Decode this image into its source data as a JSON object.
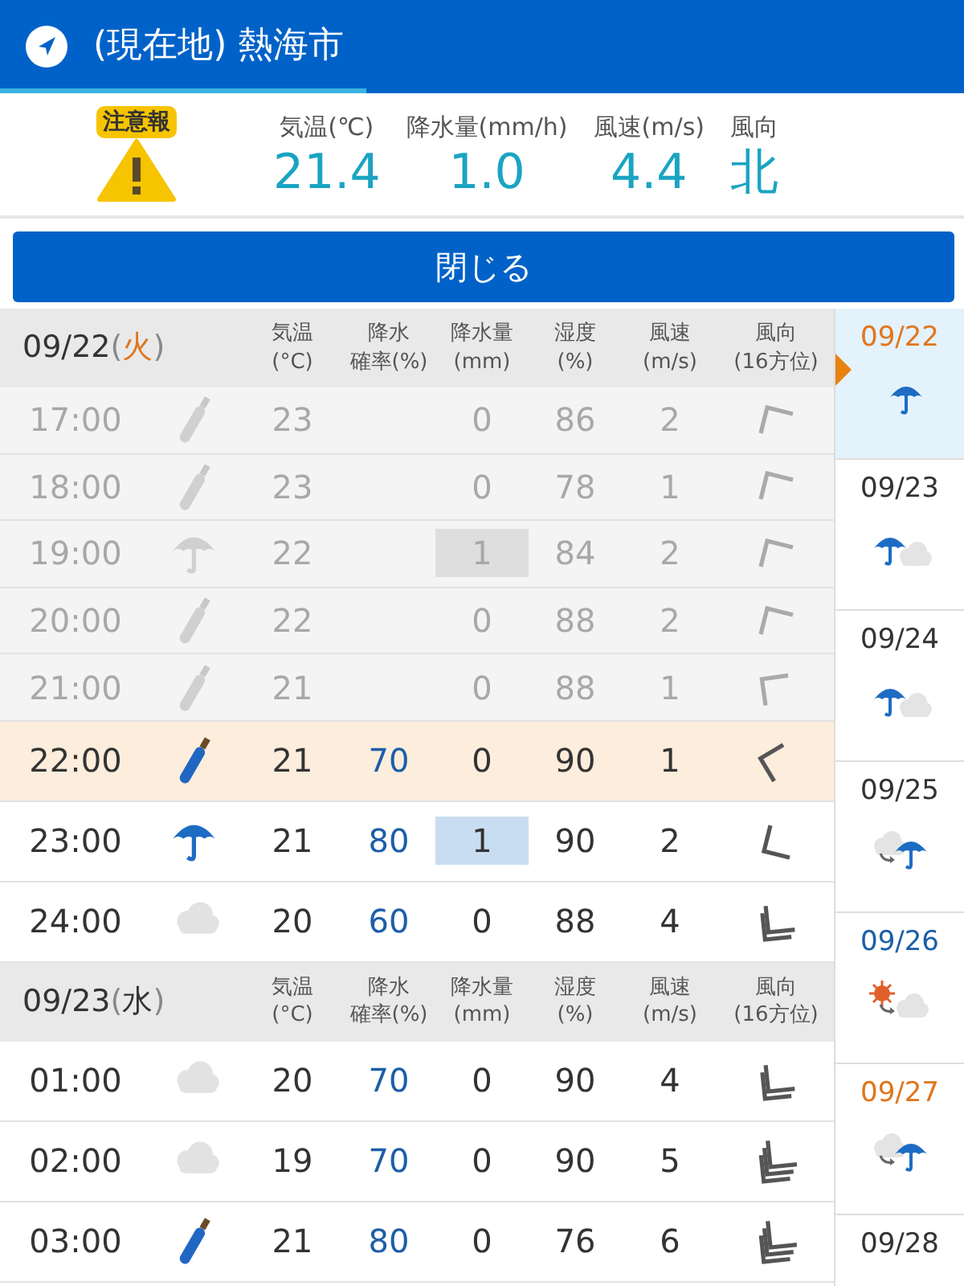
{
  "header": {
    "title": "(現在地) 熱海市"
  },
  "current": {
    "badge": "注意報",
    "readings": [
      {
        "label": "気温(℃)",
        "value": "21.4"
      },
      {
        "label": "降水量(mm/h)",
        "value": "1.0"
      },
      {
        "label": "風速(m/s)",
        "value": "4.4"
      },
      {
        "label": "風向",
        "value": "北"
      }
    ]
  },
  "close_button": "閉じる",
  "days": [
    {
      "date": "09/22",
      "weekday": "(火)",
      "color": "#e0761e",
      "columns": [
        {
          "top": "気温",
          "bottom": "(°C)"
        },
        {
          "top": "降水",
          "bottom": "確率(%)"
        },
        {
          "top": "降水量",
          "bottom": "(mm)"
        },
        {
          "top": "湿度",
          "bottom": "(%)"
        },
        {
          "top": "風速",
          "bottom": "(m/s)"
        },
        {
          "top": "風向",
          "bottom": "(16方位)"
        }
      ],
      "hours": [
        {
          "time": "17:00",
          "kind": "closed_umbrella",
          "temp": "23",
          "precip": "0",
          "humidity": "86",
          "wind": "2",
          "wind_arrow": {
            "kind": "single_nw"
          },
          "past": true,
          "current": false,
          "precip_marked": false
        },
        {
          "time": "18:00",
          "kind": "closed_umbrella",
          "temp": "23",
          "precip": "0",
          "humidity": "78",
          "wind": "1",
          "wind_arrow": {
            "kind": "single_nw"
          },
          "past": true,
          "current": false,
          "precip_marked": false
        },
        {
          "time": "19:00",
          "kind": "umbrella",
          "temp": "22",
          "precip": "1",
          "humidity": "84",
          "wind": "2",
          "wind_arrow": {
            "kind": "single_nw"
          },
          "past": true,
          "current": false,
          "precip_marked": true
        },
        {
          "time": "20:00",
          "kind": "closed_umbrella",
          "temp": "22",
          "precip": "0",
          "humidity": "88",
          "wind": "2",
          "wind_arrow": {
            "kind": "single_nw"
          },
          "past": true,
          "current": false,
          "precip_marked": false
        },
        {
          "time": "21:00",
          "kind": "closed_umbrella",
          "temp": "21",
          "precip": "0",
          "humidity": "88",
          "wind": "1",
          "wind_arrow": {
            "kind": "single_wnw"
          },
          "past": true,
          "current": false,
          "precip_marked": false
        },
        {
          "time": "22:00",
          "kind": "closed_umbrella",
          "temp": "21",
          "pop": "70",
          "precip": "0",
          "humidity": "90",
          "wind": "1",
          "wind_arrow": {
            "kind": "single_w"
          },
          "past": false,
          "current": true,
          "precip_marked": false
        },
        {
          "time": "23:00",
          "kind": "umbrella",
          "temp": "21",
          "pop": "80",
          "precip": "1",
          "humidity": "90",
          "wind": "2",
          "wind_arrow": {
            "kind": "single_sw"
          },
          "past": false,
          "current": false,
          "precip_marked": true
        },
        {
          "time": "24:00",
          "kind": "cloud",
          "temp": "20",
          "pop": "60",
          "precip": "0",
          "humidity": "88",
          "wind": "4",
          "wind_arrow": {
            "kind": "double_ssw"
          },
          "past": false,
          "current": false,
          "precip_marked": false
        }
      ]
    },
    {
      "date": "09/23",
      "weekday": "(水)",
      "color": "#333333",
      "columns": [
        {
          "top": "気温",
          "bottom": "(°C)"
        },
        {
          "top": "降水",
          "bottom": "確率(%)"
        },
        {
          "top": "降水量",
          "bottom": "(mm)"
        },
        {
          "top": "湿度",
          "bottom": "(%)"
        },
        {
          "top": "風速",
          "bottom": "(m/s)"
        },
        {
          "top": "風向",
          "bottom": "(16方位)"
        }
      ],
      "hours": [
        {
          "time": "01:00",
          "kind": "cloud",
          "temp": "20",
          "pop": "70",
          "precip": "0",
          "humidity": "90",
          "wind": "4",
          "wind_arrow": {
            "kind": "double_ssw"
          },
          "past": false,
          "current": false,
          "precip_marked": false
        },
        {
          "time": "02:00",
          "kind": "cloud",
          "temp": "19",
          "pop": "70",
          "precip": "0",
          "humidity": "90",
          "wind": "5",
          "wind_arrow": {
            "kind": "triple_ssw"
          },
          "past": false,
          "current": false,
          "precip_marked": false
        },
        {
          "time": "03:00",
          "kind": "closed_umbrella",
          "temp": "21",
          "pop": "80",
          "precip": "0",
          "humidity": "76",
          "wind": "6",
          "wind_arrow": {
            "kind": "triple_ssw"
          },
          "past": false,
          "current": false,
          "precip_marked": false
        }
      ]
    }
  ],
  "sidebar": [
    {
      "date": "09/22",
      "color": "#e0761e",
      "kind": "rain",
      "selected": true
    },
    {
      "date": "09/23",
      "color": "#333333",
      "kind": "rain_cloud",
      "selected": false
    },
    {
      "date": "09/24",
      "color": "#333333",
      "kind": "rain_cloud",
      "selected": false
    },
    {
      "date": "09/25",
      "color": "#333333",
      "kind": "cloud_then_rain",
      "selected": false
    },
    {
      "date": "09/26",
      "color": "#1c5ea8",
      "kind": "sun_then_cloud",
      "selected": false
    },
    {
      "date": "09/27",
      "color": "#e0761e",
      "kind": "cloud_then_rain",
      "selected": false
    },
    {
      "date": "09/28",
      "color": "#333333",
      "selected": false
    }
  ]
}
